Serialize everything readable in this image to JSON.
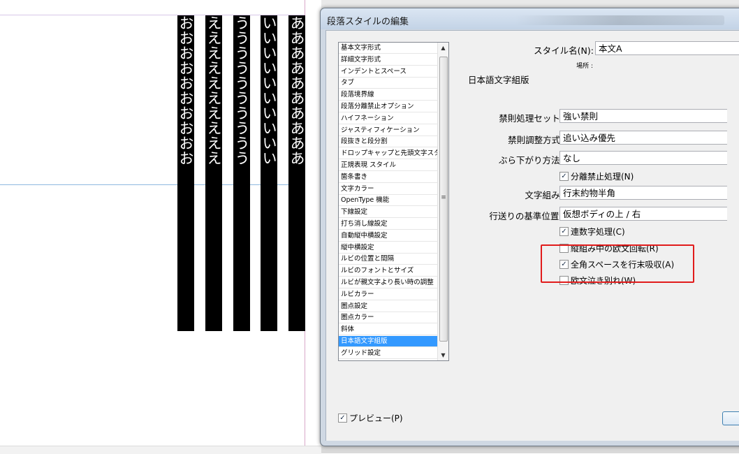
{
  "document": {
    "columns": [
      {
        "text": "おおおおおおおおおお"
      },
      {
        "text": "ええええええええええ"
      },
      {
        "text": "うううううううううう"
      },
      {
        "text": "いいいいいいいいいい"
      },
      {
        "text": "ああああああああああ"
      }
    ]
  },
  "dialog": {
    "title": "段落スタイルの編集",
    "categories": [
      "基本文字形式",
      "詳細文字形式",
      "インデントとスペース",
      "タブ",
      "段落境界線",
      "段落分離禁止オプション",
      "ハイフネーション",
      "ジャスティフィケーション",
      "段抜きと段分割",
      "ドロップキャップと先頭文字スタイル",
      "正規表現 スタイル",
      "箇条書き",
      "文字カラー",
      "OpenType 機能",
      "下線設定",
      "打ち消し線設定",
      "自動縦中横設定",
      "縦中横設定",
      "ルビの位置と間隔",
      "ルビのフォントとサイズ",
      "ルビが親文字より長い時の調整",
      "ルビカラー",
      "圏点設定",
      "圏点カラー",
      "斜体",
      "日本語文字組版",
      "グリッド設定"
    ],
    "selected_category_index": 25,
    "style_name_label": "スタイル名(N):",
    "style_name_value": "本文A",
    "location_label": "場所 :",
    "section_title": "日本語文字組版",
    "fields": {
      "kinsoku_set": {
        "label": "禁則処理セット(K):",
        "value": "強い禁則"
      },
      "kinsoku_adjust": {
        "label": "禁則調整方式(S):",
        "value": "追い込み優先"
      },
      "burasagari": {
        "label": "ぶら下がり方法(B):",
        "value": "なし"
      },
      "mojikumi": {
        "label": "文字組み(X):",
        "value": "行末約物半角"
      },
      "line_base": {
        "label": "行送りの基準位置(G):",
        "value": "仮想ボディの上 / 右"
      }
    },
    "checkboxes": {
      "bunri_kinshi": {
        "label": "分離禁止処理(N)",
        "checked": true
      },
      "renzuuji": {
        "label": "連数字処理(C)",
        "checked": true
      },
      "tate_roman": {
        "label": "縦組み中の欧文回転(R)",
        "checked": false
      },
      "zenkaku_space": {
        "label": "全角スペースを行末吸収(A)",
        "checked": true
      },
      "ouyou_nakiwakare": {
        "label": "欧文泣き別れ(W)",
        "checked": false
      }
    },
    "preview": {
      "label": "プレビュー(P)",
      "checked": true
    }
  }
}
